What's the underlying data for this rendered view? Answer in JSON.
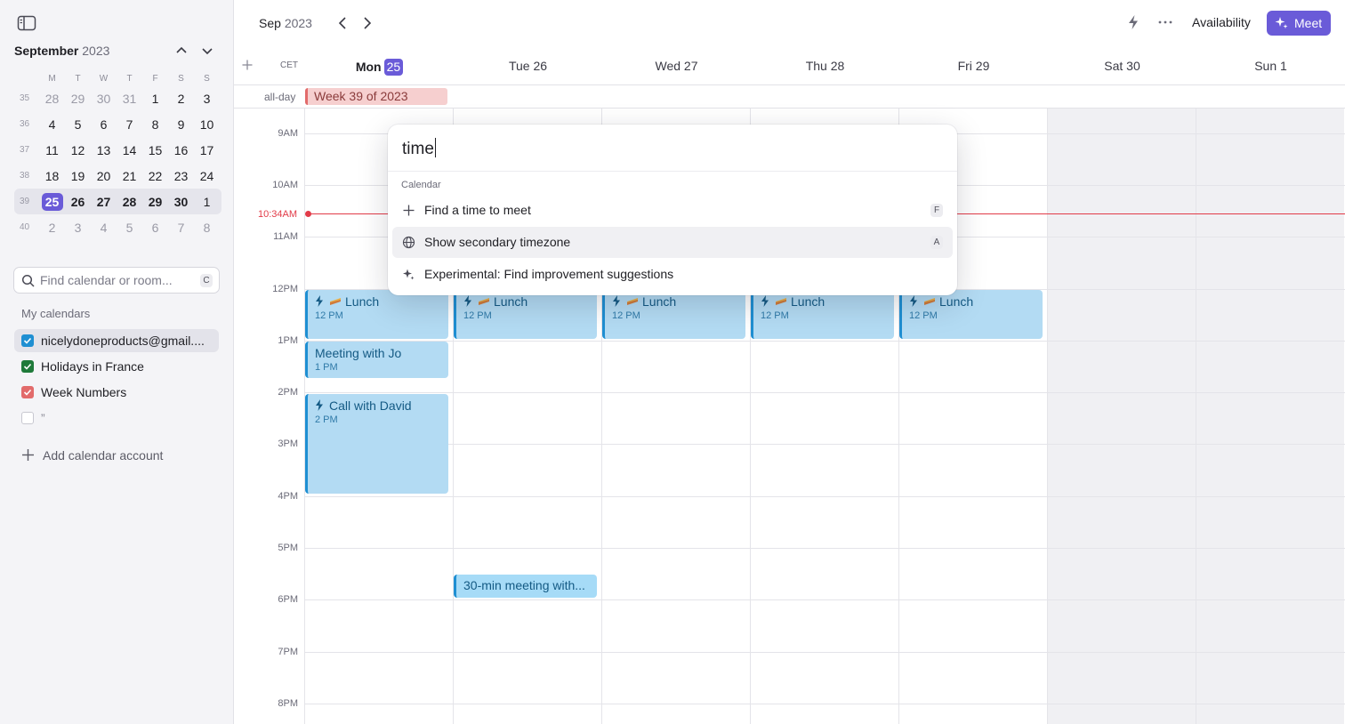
{
  "sidebar": {
    "month_label": "September",
    "year_label": "2023",
    "dow": [
      "M",
      "T",
      "W",
      "T",
      "F",
      "S",
      "S"
    ],
    "weeks": [
      {
        "wk": "35",
        "days": [
          "28",
          "29",
          "30",
          "31",
          "1",
          "2",
          "3"
        ]
      },
      {
        "wk": "36",
        "days": [
          "4",
          "5",
          "6",
          "7",
          "8",
          "9",
          "10"
        ]
      },
      {
        "wk": "37",
        "days": [
          "11",
          "12",
          "13",
          "14",
          "15",
          "16",
          "17"
        ]
      },
      {
        "wk": "38",
        "days": [
          "18",
          "19",
          "20",
          "21",
          "22",
          "23",
          "24"
        ]
      },
      {
        "wk": "39",
        "days": [
          "25",
          "26",
          "27",
          "28",
          "29",
          "30",
          "1"
        ]
      },
      {
        "wk": "40",
        "days": [
          "2",
          "3",
          "4",
          "5",
          "6",
          "7",
          "8"
        ]
      }
    ],
    "search_placeholder": "Find calendar or room...",
    "search_shortcut": "C",
    "calendars_heading": "My calendars",
    "calendars": [
      {
        "label": "nicelydoneproducts@gmail....",
        "checked": true,
        "color": "#1f8fd2"
      },
      {
        "label": "Holidays in France",
        "checked": true,
        "color": "#1f7a3a"
      },
      {
        "label": "Week Numbers",
        "checked": true,
        "color": "#e26b6b"
      },
      {
        "label": "”",
        "checked": false,
        "color": "#c8c8d0"
      }
    ],
    "add_account_label": "Add calendar account"
  },
  "topbar": {
    "month": "Sep",
    "year": "2023",
    "availability_label": "Availability",
    "meet_label": "Meet"
  },
  "dayheader": {
    "timezone": "CET",
    "days": [
      {
        "label": "Mon",
        "num": "25",
        "today": true
      },
      {
        "label": "Tue 26"
      },
      {
        "label": "Wed 27"
      },
      {
        "label": "Thu 28"
      },
      {
        "label": "Fri 29"
      },
      {
        "label": "Sat 30"
      },
      {
        "label": "Sun 1"
      }
    ]
  },
  "allday": {
    "label": "all-day",
    "event": "Week 39 of 2023"
  },
  "hours": [
    "9AM",
    "10AM",
    "11AM",
    "12PM",
    "1PM",
    "2PM",
    "3PM",
    "4PM",
    "5PM",
    "6PM",
    "7PM",
    "8PM"
  ],
  "now_label": "10:34AM",
  "events": {
    "lunch_title": "Lunch",
    "lunch_time": "12 PM",
    "meeting_jo_title": "Meeting with Jo",
    "meeting_jo_time": "1 PM",
    "call_david_title": "Call with David",
    "call_david_time": "2 PM",
    "thirty_min_title": "30-min meeting with..."
  },
  "palette": {
    "query": "time",
    "group": "Calendar",
    "items": [
      {
        "label": "Find a time to meet",
        "shortcut": "F",
        "icon": "plus-icon"
      },
      {
        "label": "Show secondary timezone",
        "shortcut": "A",
        "icon": "globe-icon"
      },
      {
        "label": "Experimental: Find improvement suggestions",
        "shortcut": "",
        "icon": "sparkles-icon"
      }
    ]
  },
  "colors": {
    "accent": "#6a5bd8",
    "event_bg": "#b3dbf3",
    "event_border": "#1f8fd2",
    "now_line": "#e23b48",
    "week_event_bg": "#f6cfcf"
  }
}
